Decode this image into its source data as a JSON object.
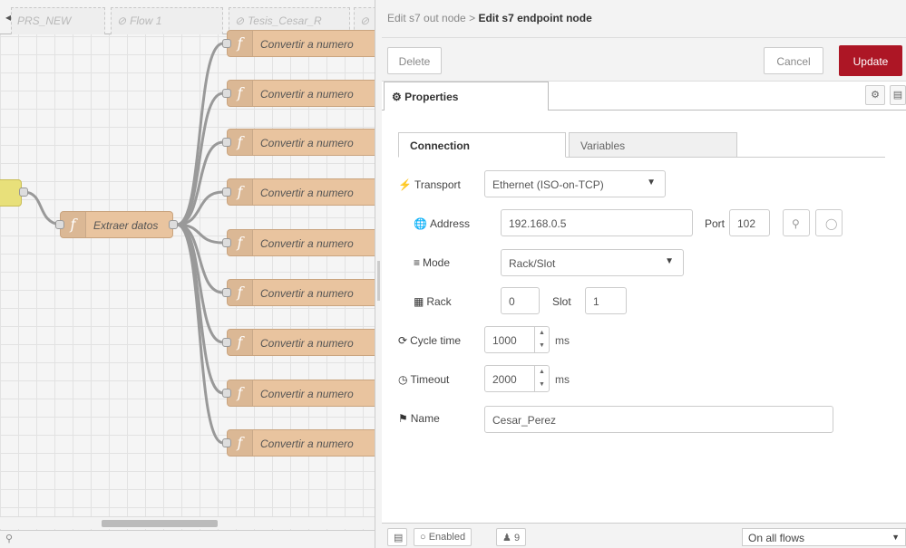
{
  "workspace": {
    "tabs": [
      {
        "label": "PRS_NEW",
        "icon": "none"
      },
      {
        "label": "Flow 1",
        "icon": "disabled-icon"
      },
      {
        "label": "Tesis_Cesar_R",
        "icon": "disabled-icon"
      }
    ],
    "nodes": {
      "extract_label": "Extraer datos",
      "convert_labels": [
        "Convertir a numero",
        "Convertir a numero",
        "Convertir a numero",
        "Convertir a numero",
        "Convertir a numero",
        "Convertir a numero",
        "Convertir a numero",
        "Convertir a numero",
        "Convertir a numero"
      ]
    },
    "node_color": "#e9c49f"
  },
  "tray": {
    "breadcrumb_parent": "Edit s7 out node",
    "breadcrumb_separator": ">",
    "breadcrumb_current": "Edit s7 endpoint node",
    "buttons": {
      "delete": "Delete",
      "cancel": "Cancel",
      "update": "Update"
    },
    "update_color": "#ad1625",
    "tab_properties": "Properties",
    "inner_tabs": {
      "connection": "Connection",
      "variables": "Variables"
    },
    "fields": {
      "transport_label": "Transport",
      "transport_value": "Ethernet (ISO-on-TCP)",
      "address_label": "Address",
      "address_value": "192.168.0.5",
      "port_label": "Port",
      "port_value": "102",
      "mode_label": "Mode",
      "mode_value": "Rack/Slot",
      "rack_label": "Rack",
      "rack_value": "0",
      "slot_label": "Slot",
      "slot_value": "1",
      "cycle_label": "Cycle time",
      "cycle_value": "1000",
      "cycle_unit": "ms",
      "timeout_label": "Timeout",
      "timeout_value": "2000",
      "timeout_unit": "ms",
      "name_label": "Name",
      "name_value": "Cesar_Perez"
    },
    "footer": {
      "enabled_label": "Enabled",
      "users_count": "9",
      "scope_value": "On all flows"
    }
  }
}
